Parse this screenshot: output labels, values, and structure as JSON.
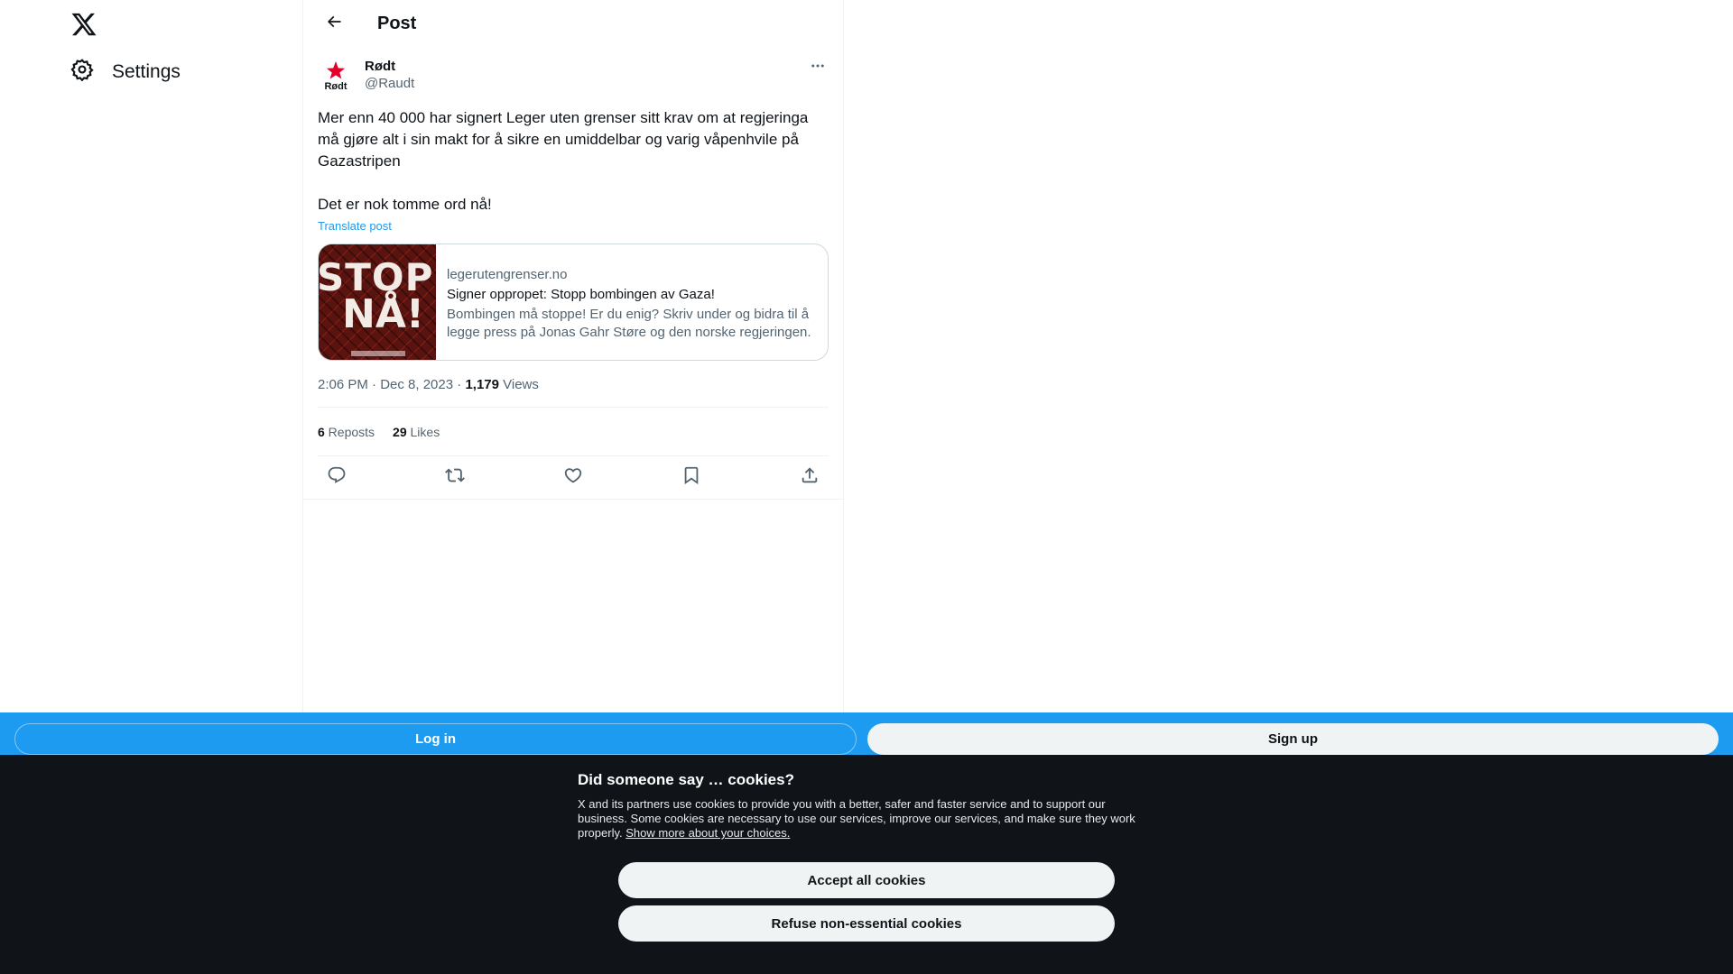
{
  "nav": {
    "settings_label": "Settings"
  },
  "header": {
    "title": "Post"
  },
  "post": {
    "author_name": "Rødt",
    "author_handle": "@Raudt",
    "avatar_text": "Rødt",
    "text": "Mer enn 40 000 har signert Leger uten grenser sitt krav om at regjeringa må gjøre alt i sin makt for å sikre en umiddelbar og varig våpenhvile på Gazastripen\n\nDet er nok tomme ord nå!",
    "translate_label": "Translate post",
    "card": {
      "image_text_1": "STOPP",
      "image_text_2": "NÅ!",
      "domain": "legerutengrenser.no",
      "title": "Signer oppropet: Stopp bombingen av Gaza!",
      "description": "Bombingen må stoppe! Er du enig? Skriv under og bidra til å legge press på Jonas Gahr Støre og den norske regjeringen."
    },
    "timestamp": "2:06 PM · Dec 8, 2023",
    "separator": " · ",
    "views_count": "1,179",
    "views_label": " Views",
    "reposts_count": "6",
    "reposts_label": " Reposts",
    "likes_count": "29",
    "likes_label": " Likes"
  },
  "bottombar": {
    "login_label": "Log in",
    "signup_label": "Sign up"
  },
  "cookie": {
    "title": "Did someone say … cookies?",
    "text": "X and its partners use cookies to provide you with a better, safer and faster service and to support our business. Some cookies are necessary to use our services, improve our services, and make sure they work properly. ",
    "link": "Show more about your choices.",
    "accept_label": "Accept all cookies",
    "refuse_label": "Refuse non-essential cookies"
  },
  "colors": {
    "accent": "#1d9bf0",
    "banner_bg": "#101419",
    "brand_red": "#e4002b"
  },
  "icons": [
    "x-logo-icon",
    "gear-icon",
    "back-arrow-icon",
    "more-icon",
    "reply-icon",
    "repost-icon",
    "like-icon",
    "bookmark-icon",
    "share-icon"
  ]
}
